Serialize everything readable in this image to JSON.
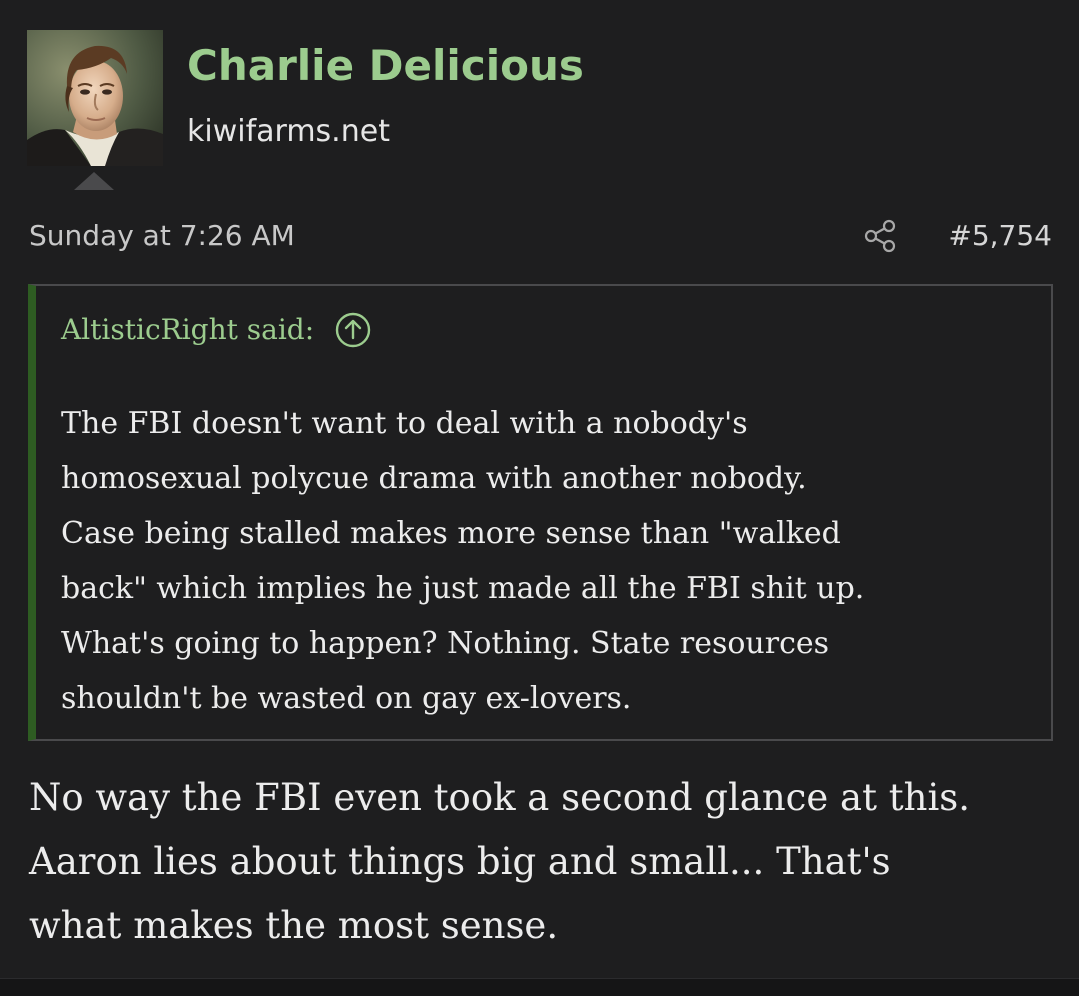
{
  "colors": {
    "page_bg": "#1e1e1f",
    "username": "#9ccc8e",
    "quote_accent": "#2e5c22",
    "quote_border": "#4a4a4c",
    "text": "#ececec"
  },
  "user": {
    "avatar_icon": "user-avatar-portrait",
    "name": "Charlie Delicious",
    "title": "kiwifarms.net"
  },
  "post": {
    "date": "Sunday at 7:26 AM",
    "share_icon": "share-icon",
    "number": "#5,754"
  },
  "quote": {
    "author_label": "AltisticRight said:",
    "expand_icon": "arrow-up-circle-icon",
    "lines": [
      "The FBI doesn't want to deal with a nobody's",
      "homosexual polycue drama with another nobody.",
      "Case being stalled makes more sense than \"walked",
      "back\" which implies he just made all the FBI shit up.",
      "What's going to happen? Nothing. State resources",
      "shouldn't be wasted on gay ex-lovers."
    ]
  },
  "reply": {
    "lines": [
      "No way the FBI even took a second glance at this.",
      "Aaron lies about things big and small... That's",
      "what makes the most sense."
    ]
  }
}
